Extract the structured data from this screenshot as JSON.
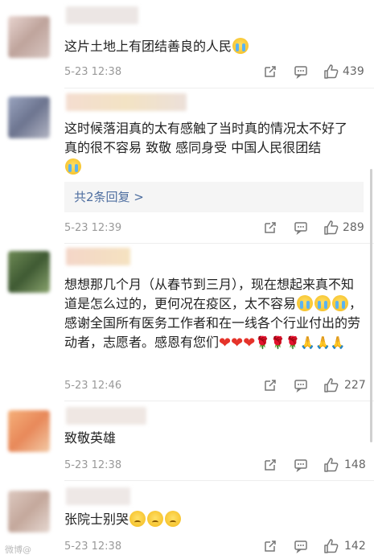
{
  "comments": [
    {
      "text": "这片土地上有团结善良的人民",
      "time": "5-23 12:38",
      "likes": "439"
    },
    {
      "text": "这时候落泪真的太有感触了当时真的情况太不好了 真的很不容易 致敬 感同身受 中国人民很团结",
      "reply": "共2条回复 >",
      "time": "5-23 12:39",
      "likes": "289"
    },
    {
      "text_line1": "想想那几个月（从春节到三月），现在想起来真不知道是怎么过的，更何况在疫区，太不容易",
      "text_line2": "，感谢全国所有医务工作者和在一线各个行业付出的劳动者，志愿者。感恩有您们",
      "time": "5-23 12:46",
      "likes": "227"
    },
    {
      "text": "致敬英雄",
      "time": "5-23 12:38",
      "likes": "148"
    },
    {
      "text": "张院士别哭",
      "time": "5-23 12:38",
      "likes": "142"
    }
  ],
  "watermark": "微博@",
  "colors": {
    "link": "#4e6ea0",
    "meta": "#999999",
    "heart": "#e5332a"
  },
  "icons": [
    "share-icon",
    "comment-icon",
    "like-icon",
    "cry-emoji",
    "sad-emoji",
    "heart-emoji",
    "rose-emoji",
    "pray-emoji"
  ]
}
